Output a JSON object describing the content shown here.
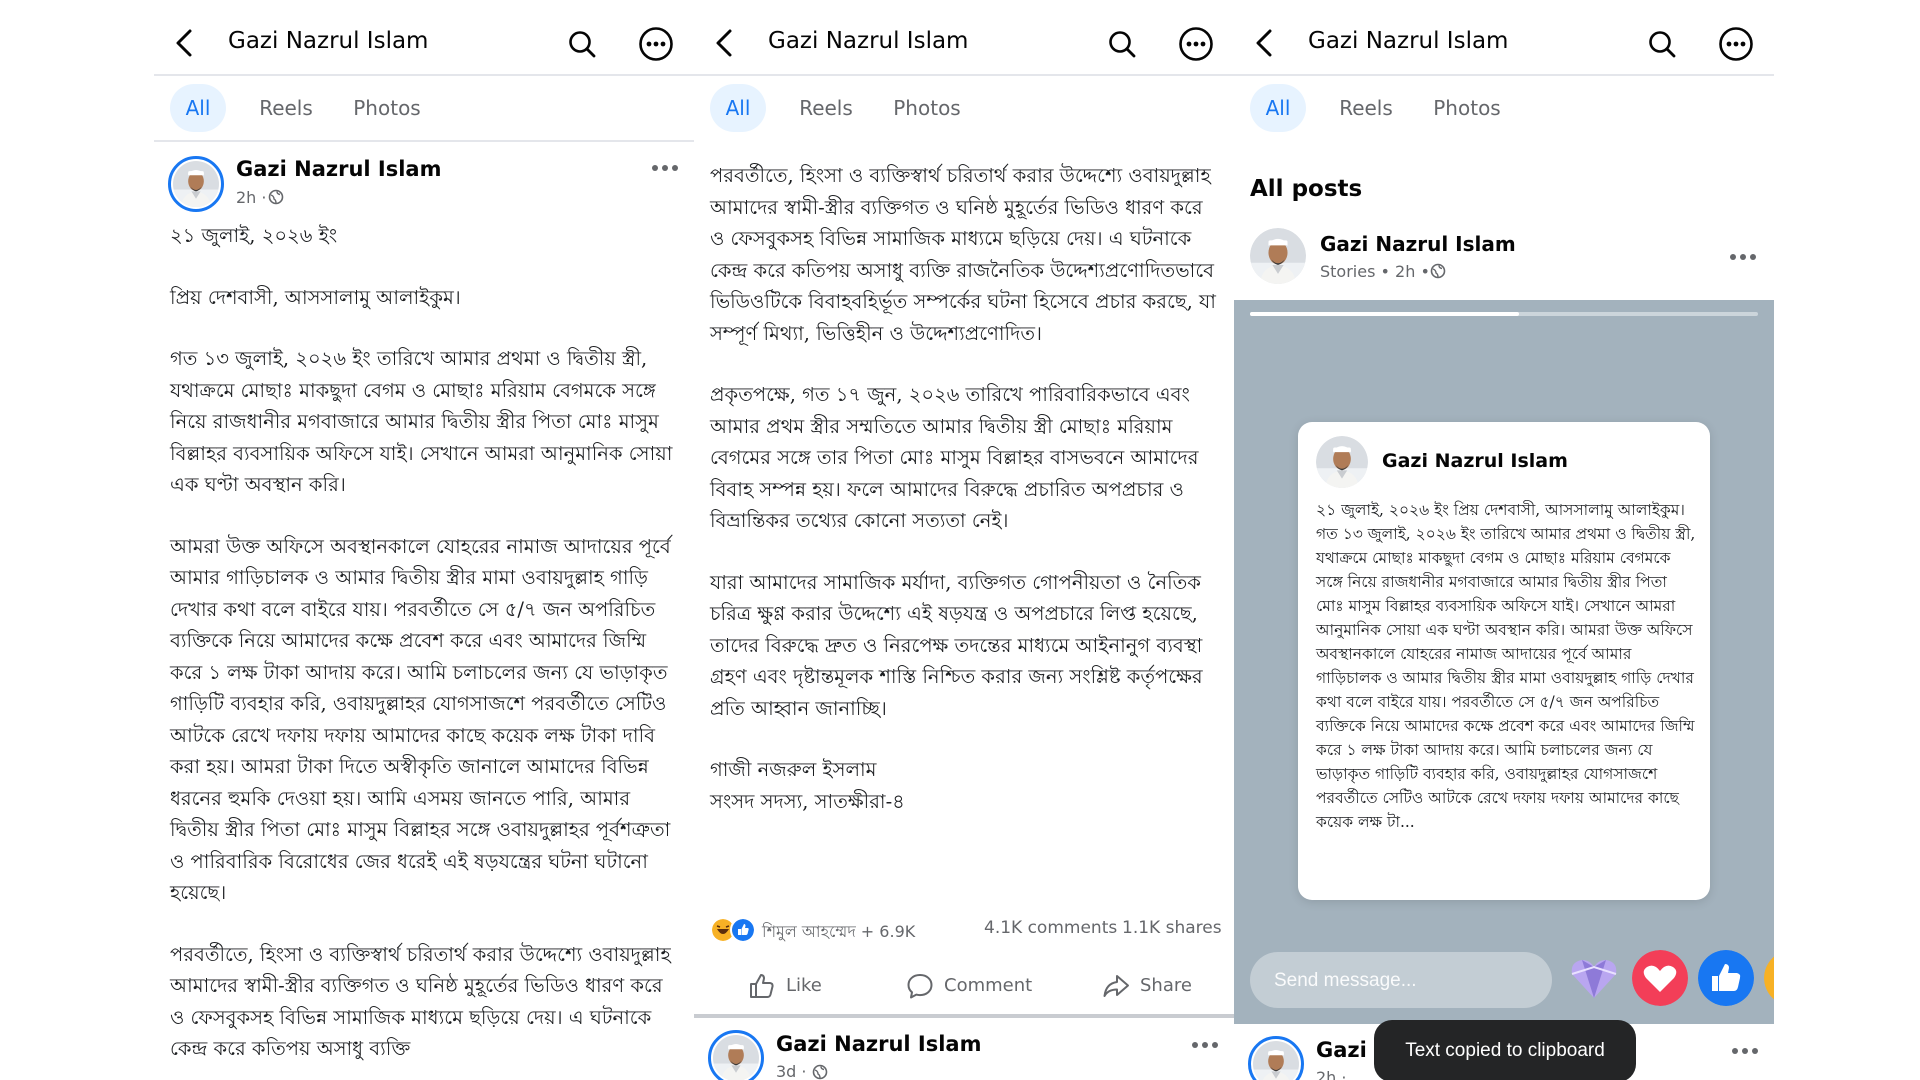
{
  "colors": {
    "accent": "#1877f2",
    "tab_active_bg": "#e7f3ff",
    "story_bg": "#a3b2bd",
    "toast_bg": "#242526",
    "love": "#f33e58"
  },
  "icons": [
    "back-arrow-icon",
    "search-icon",
    "more-icon",
    "globe-icon",
    "like-icon",
    "comment-icon",
    "share-icon",
    "heart-icon",
    "thumbs-up-icon"
  ],
  "panels": [
    {
      "topbar": {
        "title": "Gazi Nazrul Islam"
      },
      "tabs": [
        "All",
        "Reels",
        "Photos"
      ],
      "post": {
        "author": "Gazi Nazrul Islam",
        "time": "2h ·",
        "date_line": "২১ জুলাই, ২০২৬ ইং",
        "paragraphs": [
          "প্রিয় দেশবাসী, আসসালামু আলাইকুম।",
          "গত ১৩ জুলাই, ২০২৬ ইং তারিখে আমার প্রথমা ও দ্বিতীয় স্ত্রী, যথাক্রমে মোছাঃ মাকছুদা বেগম ও মোছাঃ মরিয়াম বেগমকে সঙ্গে নিয়ে রাজধানীর মগবাজারে আমার দ্বিতীয় স্ত্রীর পিতা মোঃ মাসুম বিল্লাহর ব্যবসায়িক অফিসে যাই। সেখানে আমরা আনুমানিক সোয়া এক ঘণ্টা অবস্থান করি।",
          "আমরা উক্ত অফিসে অবস্থানকালে যোহরের নামাজ আদায়ের পূর্বে আমার গাড়িচালক ও আমার দ্বিতীয় স্ত্রীর মামা ওবায়দুল্লাহ গাড়ি দেখার কথা বলে বাইরে যায়। পরবর্তীতে সে ৫/৭ জন অপরিচিত ব্যক্তিকে নিয়ে আমাদের কক্ষে প্রবেশ করে এবং আমাদের জিম্মি করে ১ লক্ষ টাকা আদায় করে। আমি চলাচলের জন্য যে ভাড়াকৃত গাড়িটি ব্যবহার করি, ওবায়দুল্লাহর যোগসাজশে পরবর্তীতে সেটিও আটকে রেখে দফায় দফায় আমাদের কাছে কয়েক লক্ষ টাকা দাবি করা হয়। আমরা টাকা দিতে অস্বীকৃতি জানালে আমাদের বিভিন্ন ধরনের হুমকি দেওয়া হয়। আমি এসময় জানতে পারি, আমার দ্বিতীয় স্ত্রীর পিতা মোঃ মাসুম বিল্লাহর সঙ্গে ওবায়দুল্লাহর পূর্বশত্রুতা ও পারিবারিক বিরোধের জের ধরেই এই ষড়যন্ত্রের ঘটনা ঘটানো হয়েছে।",
          "পরবর্তীতে, হিংসা ও ব্যক্তিস্বার্থ চরিতার্থ করার উদ্দেশ্যে ওবায়দুল্লাহ আমাদের স্বামী-স্ত্রীর ব্যক্তিগত ও ঘনিষ্ঠ মুহূর্তের ভিডিও ধারণ করে ও ফেসবুকসহ বিভিন্ন সামাজিক মাধ্যমে ছড়িয়ে দেয়। এ ঘটনাকে কেন্দ্র করে কতিপয় অসাধু ব্যক্তি"
        ]
      }
    },
    {
      "topbar": {
        "title": "Gazi Nazrul Islam"
      },
      "tabs": [
        "All",
        "Reels",
        "Photos"
      ],
      "post": {
        "paragraphs": [
          "পরবর্তীতে, হিংসা ও ব্যক্তিস্বার্থ চরিতার্থ করার উদ্দেশ্যে ওবায়দুল্লাহ আমাদের স্বামী-স্ত্রীর ব্যক্তিগত ও ঘনিষ্ঠ মুহূর্তের ভিডিও ধারণ করে ও ফেসবুকসহ বিভিন্ন সামাজিক মাধ্যমে ছড়িয়ে দেয়। এ ঘটনাকে কেন্দ্র করে কতিপয় অসাধু ব্যক্তি রাজনৈতিক উদ্দেশ্যপ্রণোদিতভাবে ভিডিওটিকে বিবাহবহির্ভূত সম্পর্কের ঘটনা হিসেবে প্রচার করছে, যা সম্পূর্ণ মিথ্যা, ভিত্তিহীন ও উদ্দেশ্যপ্রণোদিত।",
          "প্রকৃতপক্ষে, গত ১৭ জুন, ২০২৬ তারিখে পারিবারিকভাবে এবং আমার প্রথম স্ত্রীর সম্মতিতে আমার দ্বিতীয় স্ত্রী মোছাঃ মরিয়াম বেগমের সঙ্গে তার পিতা মোঃ মাসুম বিল্লাহর বাসভবনে আমাদের বিবাহ সম্পন্ন হয়। ফলে আমাদের বিরুদ্ধে প্রচারিত অপপ্রচার ও বিভ্রান্তিকর তথ্যের কোনো সত্যতা নেই।",
          "যারা আমাদের সামাজিক মর্যাদা, ব্যক্তিগত গোপনীয়তা ও নৈতিক চরিত্র ক্ষুণ্ণ করার উদ্দেশ্যে এই ষড়যন্ত্র ও অপপ্রচারে লিপ্ত হয়েছে, তাদের বিরুদ্ধে দ্রুত ও নিরপেক্ষ তদন্তের মাধ্যমে আইনানুগ ব্যবস্থা গ্রহণ এবং দৃষ্টান্তমূলক শাস্তি নিশ্চিত করার জন্য সংশ্লিষ্ট কর্তৃপক্ষের প্রতি আহ্বান জানাচ্ছি।"
        ],
        "signature": [
          "গাজী নজরুল ইসলাম",
          "সংসদ সদস্য, সাতক্ষীরা-৪"
        ],
        "reactions_text": "শিমুল আহম্মেদ + 6.9K",
        "comments": "4.1K comments",
        "shares": "1.1K shares",
        "actions": {
          "like": "Like",
          "comment": "Comment",
          "share": "Share"
        }
      },
      "next_post": {
        "author": "Gazi Nazrul Islam",
        "time": "3d ·"
      }
    },
    {
      "topbar": {
        "title": "Gazi Nazrul Islam"
      },
      "tabs": [
        "All",
        "Reels",
        "Photos"
      ],
      "section_title": "All posts",
      "story_post": {
        "author": "Gazi Nazrul Islam",
        "meta": "Stories • 2h •"
      },
      "story": {
        "progress": 0.53,
        "card_author": "Gazi Nazrul Islam",
        "card_text": "২১ জুলাই, ২০২৬ ইং প্রিয় দেশবাসী, আসসালামু আলাইকুম। গত ১৩ জুলাই, ২০২৬ ইং তারিখে আমার প্রথমা ও দ্বিতীয় স্ত্রী, যথাক্রমে মোছাঃ মাকছুদা বেগম ও মোছাঃ মরিয়াম বেগমকে সঙ্গে নিয়ে রাজধানীর মগবাজারে আমার দ্বিতীয় স্ত্রীর পিতা মোঃ মাসুম বিল্লাহর ব্যবসায়িক অফিসে যাই। সেখানে আমরা আনুমানিক সোয়া এক ঘণ্টা অবস্থান করি। আমরা উক্ত অফিসে অবস্থানকালে যোহরের নামাজ আদায়ের পূর্বে আমার গাড়িচালক ও আমার দ্বিতীয় স্ত্রীর মামা ওবায়দুল্লাহ গাড়ি দেখার কথা বলে বাইরে যায়। পরবর্তীতে সে ৫/৭ জন অপরিচিত ব্যক্তিকে নিয়ে আমাদের কক্ষে প্রবেশ করে এবং আমাদের জিম্মি করে ১ লক্ষ টাকা আদায় করে। আমি চলাচলের জন্য যে ভাড়াকৃত গাড়িটি ব্যবহার করি, ওবায়দুল্লাহর যোগসাজশে পরবর্তীতে সেটিও আটকে রেখে দফায় দফায় আমাদের কাছে কয়েক লক্ষ টা...",
        "send_placeholder": "Send message..."
      },
      "next_post": {
        "author": "Gazi N",
        "time": "2h ·"
      },
      "toast": "Text copied to clipboard"
    }
  ]
}
